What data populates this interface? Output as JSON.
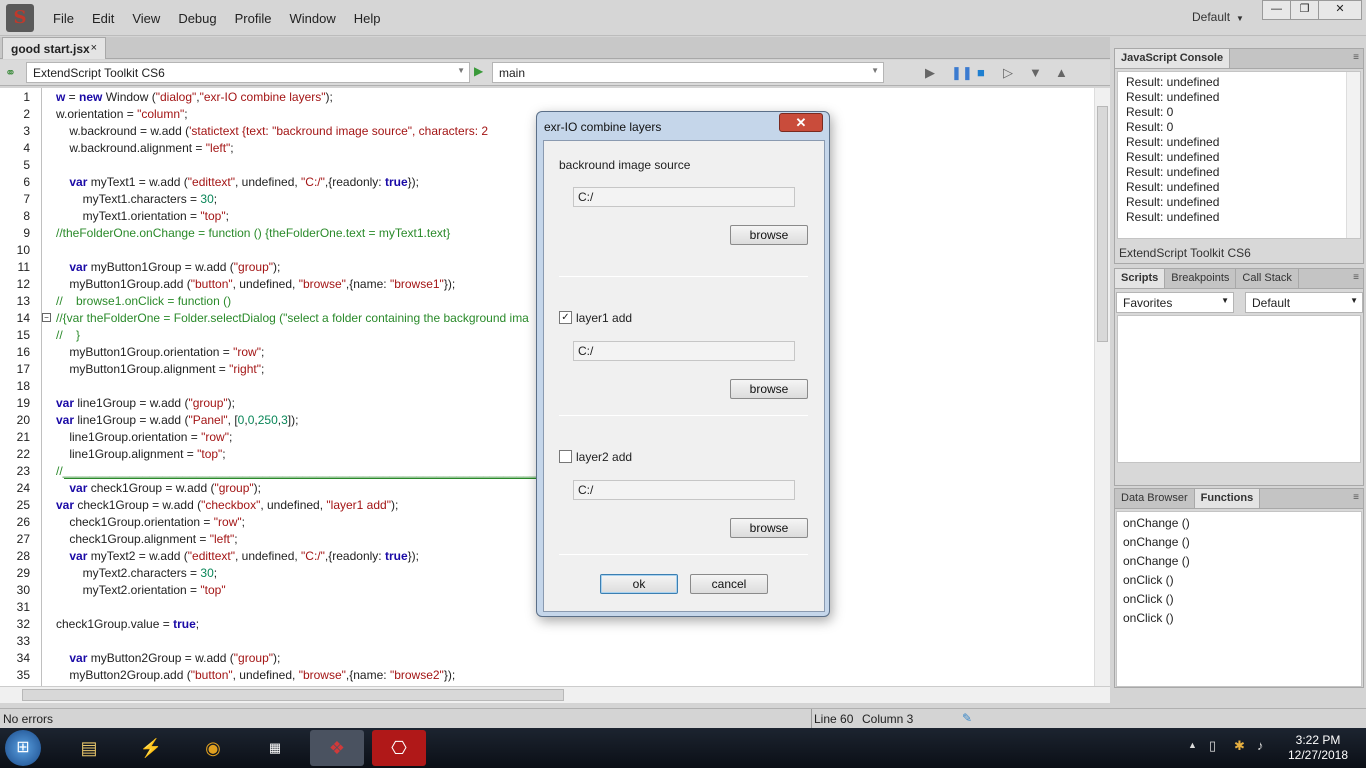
{
  "menubar": {
    "items": [
      "File",
      "Edit",
      "View",
      "Debug",
      "Profile",
      "Window",
      "Help"
    ],
    "workspace": "Default",
    "logo_glyph": "S"
  },
  "editor_tab": {
    "label": "good start.jsx",
    "close": "×"
  },
  "target_bar": {
    "target_app": "ExtendScript Toolkit CS6",
    "engine": "main"
  },
  "editor": {
    "line_numbers": [
      "1",
      "2",
      "3",
      "4",
      "5",
      "6",
      "7",
      "8",
      "9",
      "10",
      "11",
      "12",
      "13",
      "14",
      "15",
      "16",
      "17",
      "18",
      "19",
      "20",
      "21",
      "22",
      "23",
      "24",
      "25",
      "26",
      "27",
      "28",
      "29",
      "30",
      "31",
      "32",
      "33",
      "34",
      "35"
    ],
    "lines": [
      [
        [
          "kw",
          "w"
        ],
        [
          "p",
          " = "
        ],
        [
          "kw",
          "new"
        ],
        [
          "p",
          " Window ("
        ],
        [
          "str",
          "\"dialog\""
        ],
        [
          "p",
          ","
        ],
        [
          "str",
          "\"exr-IO combine layers\""
        ],
        [
          "p",
          ");"
        ]
      ],
      [
        [
          "p",
          "w.orientation = "
        ],
        [
          "str",
          "\"column\""
        ],
        [
          "p",
          ";"
        ]
      ],
      [
        [
          "p",
          "    w.backround = w.add ("
        ],
        [
          "str",
          "'statictext {text: \"backround image source\", characters: 2"
        ]
      ],
      [
        [
          "p",
          "    w.backround.alignment = "
        ],
        [
          "str",
          "\"left\""
        ],
        [
          "p",
          ";"
        ]
      ],
      [],
      [
        [
          "p",
          "    "
        ],
        [
          "kw",
          "var"
        ],
        [
          "p",
          " myText1 = w.add ("
        ],
        [
          "str",
          "\"edittext\""
        ],
        [
          "p",
          ", undefined, "
        ],
        [
          "str",
          "\"C:/\""
        ],
        [
          "p",
          ",{readonly: "
        ],
        [
          "kw",
          "true"
        ],
        [
          "p",
          "});"
        ]
      ],
      [
        [
          "p",
          "        myText1.characters = "
        ],
        [
          "num",
          "30"
        ],
        [
          "p",
          ";"
        ]
      ],
      [
        [
          "p",
          "        myText1.orientation = "
        ],
        [
          "str",
          "\"top\""
        ],
        [
          "p",
          ";"
        ]
      ],
      [
        [
          "cm",
          "//theFolderOne.onChange = function () {theFolderOne.text = myText1.text}"
        ]
      ],
      [],
      [
        [
          "p",
          "    "
        ],
        [
          "kw",
          "var"
        ],
        [
          "p",
          " myButton1Group = w.add ("
        ],
        [
          "str",
          "\"group\""
        ],
        [
          "p",
          ");"
        ]
      ],
      [
        [
          "p",
          "    myButton1Group.add ("
        ],
        [
          "str",
          "\"button\""
        ],
        [
          "p",
          ", undefined, "
        ],
        [
          "str",
          "\"browse\""
        ],
        [
          "p",
          ",{name: "
        ],
        [
          "str",
          "\"browse1\""
        ],
        [
          "p",
          "});"
        ]
      ],
      [
        [
          "cm",
          "//    browse1.onClick = function ()"
        ]
      ],
      [
        [
          "cm",
          "//{var theFolderOne = Folder.selectDialog (\"select a folder containing the background ima"
        ]
      ],
      [
        [
          "cm",
          "//    }"
        ]
      ],
      [
        [
          "p",
          "    myButton1Group.orientation = "
        ],
        [
          "str",
          "\"row\""
        ],
        [
          "p",
          ";"
        ]
      ],
      [
        [
          "p",
          "    myButton1Group.alignment = "
        ],
        [
          "str",
          "\"right\""
        ],
        [
          "p",
          ";"
        ]
      ],
      [],
      [
        [
          "kw",
          "var"
        ],
        [
          "p",
          " line1Group = w.add ("
        ],
        [
          "str",
          "\"group\""
        ],
        [
          "p",
          ");"
        ]
      ],
      [
        [
          "kw",
          "var"
        ],
        [
          "p",
          " line1Group = w.add ("
        ],
        [
          "str",
          "\"Panel\""
        ],
        [
          "p",
          ", ["
        ],
        [
          "num",
          "0"
        ],
        [
          "p",
          ","
        ],
        [
          "num",
          "0"
        ],
        [
          "p",
          ","
        ],
        [
          "num",
          "250"
        ],
        [
          "p",
          ","
        ],
        [
          "num",
          "3"
        ],
        [
          "p",
          "]);"
        ]
      ],
      [
        [
          "p",
          "    line1Group.orientation = "
        ],
        [
          "str",
          "\"row\""
        ],
        [
          "p",
          ";"
        ]
      ],
      [
        [
          "p",
          "    line1Group.alignment = "
        ],
        [
          "str",
          "\"top\""
        ],
        [
          "p",
          ";"
        ]
      ],
      [
        [
          "cm",
          "//________________________________________________________________________________________________"
        ]
      ],
      [
        [
          "p",
          "    "
        ],
        [
          "kw",
          "var"
        ],
        [
          "p",
          " check1Group = w.add ("
        ],
        [
          "str",
          "\"group\""
        ],
        [
          "p",
          ");"
        ]
      ],
      [
        [
          "kw",
          "var"
        ],
        [
          "p",
          " check1Group = w.add ("
        ],
        [
          "str",
          "\"checkbox\""
        ],
        [
          "p",
          ", undefined, "
        ],
        [
          "str",
          "\"layer1 add\""
        ],
        [
          "p",
          ");"
        ]
      ],
      [
        [
          "p",
          "    check1Group.orientation = "
        ],
        [
          "str",
          "\"row\""
        ],
        [
          "p",
          ";"
        ]
      ],
      [
        [
          "p",
          "    check1Group.alignment = "
        ],
        [
          "str",
          "\"left\""
        ],
        [
          "p",
          ";"
        ]
      ],
      [
        [
          "p",
          "    "
        ],
        [
          "kw",
          "var"
        ],
        [
          "p",
          " myText2 = w.add ("
        ],
        [
          "str",
          "\"edittext\""
        ],
        [
          "p",
          ", undefined, "
        ],
        [
          "str",
          "\"C:/\""
        ],
        [
          "p",
          ",{readonly: "
        ],
        [
          "kw",
          "true"
        ],
        [
          "p",
          "});"
        ]
      ],
      [
        [
          "p",
          "        myText2.characters = "
        ],
        [
          "num",
          "30"
        ],
        [
          "p",
          ";"
        ]
      ],
      [
        [
          "p",
          "        myText2.orientation = "
        ],
        [
          "str",
          "\"top\""
        ]
      ],
      [],
      [
        [
          "p",
          "check1Group.value = "
        ],
        [
          "kw",
          "true"
        ],
        [
          "p",
          ";"
        ]
      ],
      [],
      [
        [
          "p",
          "    "
        ],
        [
          "kw",
          "var"
        ],
        [
          "p",
          " myButton2Group = w.add ("
        ],
        [
          "str",
          "\"group\""
        ],
        [
          "p",
          ");"
        ]
      ],
      [
        [
          "p",
          "    myButton2Group.add ("
        ],
        [
          "str",
          "\"button\""
        ],
        [
          "p",
          ", undefined, "
        ],
        [
          "str",
          "\"browse\""
        ],
        [
          "p",
          ",{name: "
        ],
        [
          "str",
          "\"browse2\""
        ],
        [
          "p",
          "});"
        ]
      ]
    ]
  },
  "status": {
    "message": "No errors",
    "line": "Line 60",
    "column": "Column 3"
  },
  "console": {
    "tab": "JavaScript Console",
    "lines": [
      "Result: undefined",
      "Result: undefined",
      "Result: 0",
      "Result: 0",
      "Result: undefined",
      "Result: undefined",
      "Result: undefined",
      "Result: undefined",
      "Result: undefined",
      "Result: undefined"
    ],
    "footer": "ExtendScript Toolkit CS6"
  },
  "scripts_panel": {
    "tabs": [
      "Scripts",
      "Breakpoints",
      "Call Stack"
    ],
    "favorites": "Favorites",
    "default": "Default"
  },
  "functions_panel": {
    "tabs": [
      "Data Browser",
      "Functions"
    ],
    "items": [
      "onChange ()",
      "onChange ()",
      "onChange ()",
      "onClick ()",
      "onClick ()",
      "onClick ()"
    ]
  },
  "dialog": {
    "title": "exr-IO combine layers",
    "close": "✕",
    "background_label": "backround image source",
    "background_value": "C:/",
    "browse": "browse",
    "layer1_label": "layer1 add",
    "layer1_checked": true,
    "layer1_value": "C:/",
    "layer2_label": "layer2 add",
    "layer2_checked": false,
    "layer2_value": "C:/",
    "ok": "ok",
    "cancel": "cancel",
    "check_mark": "✓"
  },
  "taskbar": {
    "time": "3:22 PM",
    "date": "12/27/2018"
  }
}
